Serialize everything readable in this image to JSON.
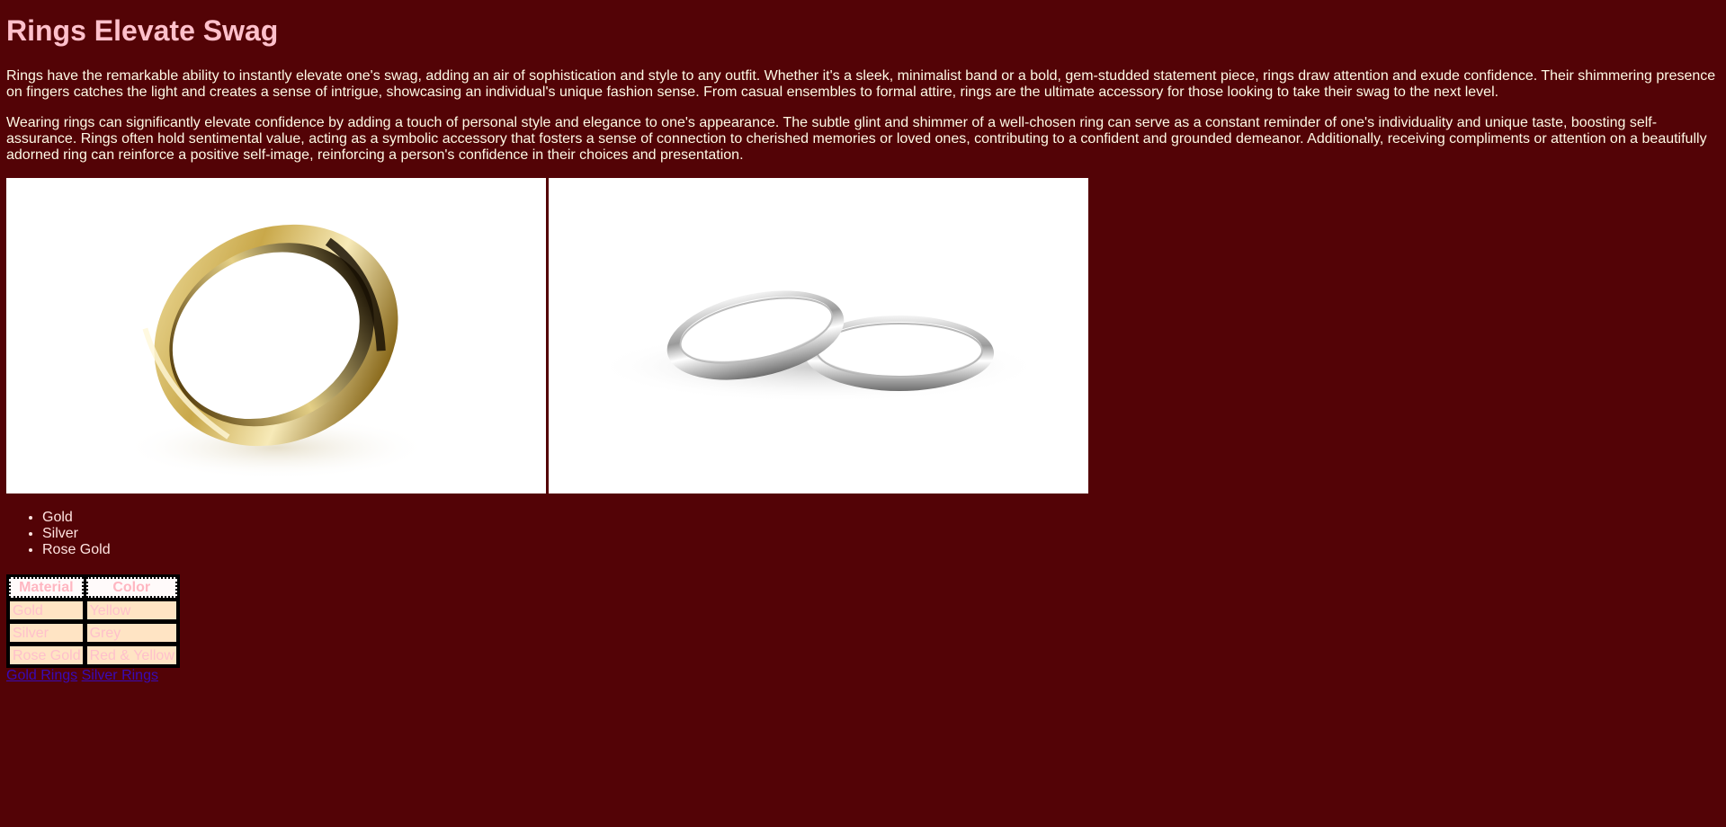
{
  "page": {
    "title": "Rings Elevate Swag",
    "paragraphs": [
      "Rings have the remarkable ability to instantly elevate one's swag, adding an air of sophistication and style to any outfit. Whether it's a sleek, minimalist band or a bold, gem-studded statement piece, rings draw attention and exude confidence. Their shimmering presence on fingers catches the light and creates a sense of intrigue, showcasing an individual's unique fashion sense. From casual ensembles to formal attire, rings are the ultimate accessory for those looking to take their swag to the next level.",
      "Wearing rings can significantly elevate confidence by adding a touch of personal style and elegance to one's appearance. The subtle glint and shimmer of a well-chosen ring can serve as a constant reminder of one's individuality and unique taste, boosting self-assurance. Rings often hold sentimental value, acting as a symbolic accessory that fosters a sense of connection to cherished memories or loved ones, contributing to a confident and grounded demeanor. Additionally, receiving compliments or attention on a beautifully adorned ring can reinforce a positive self-image, reinforcing a person's confidence in their choices and presentation."
    ]
  },
  "images": [
    {
      "icon": "gold-ring-image"
    },
    {
      "icon": "silver-rings-image"
    }
  ],
  "list": [
    "Gold",
    "Silver",
    "Rose Gold"
  ],
  "table": {
    "headers": [
      "Material",
      "Color"
    ],
    "rows": [
      [
        "Gold",
        "Yellow"
      ],
      [
        "Silver",
        "Grey"
      ],
      [
        "Rose Gold",
        "Red & Yellow"
      ]
    ]
  },
  "links": [
    "Gold Rings",
    "Silver Rings"
  ],
  "colors": {
    "background": "#530306",
    "title": "#ffc0cb",
    "link": "#3a0ab8"
  }
}
